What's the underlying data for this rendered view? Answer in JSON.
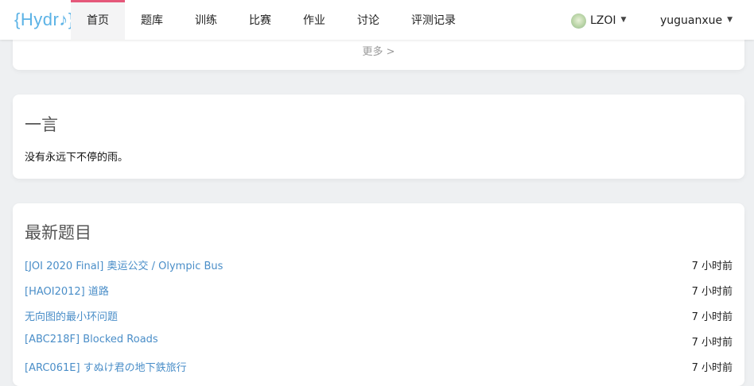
{
  "brand": {
    "logo_text": "{Hydr♪}",
    "accent": "#e5587a",
    "link_color": "#4a8ec8"
  },
  "nav": {
    "items": [
      {
        "label": "首页",
        "active": true
      },
      {
        "label": "题库"
      },
      {
        "label": "训练"
      },
      {
        "label": "比赛"
      },
      {
        "label": "作业"
      },
      {
        "label": "讨论"
      },
      {
        "label": "评测记录"
      }
    ],
    "domain": {
      "label": "LZOI",
      "icon": "domain-avatar"
    },
    "user": {
      "label": "yuguanxue"
    }
  },
  "more": {
    "label": "更多 >"
  },
  "hitokoto": {
    "title": "一言",
    "text": "没有永远下不停的雨。"
  },
  "latest": {
    "title": "最新题目",
    "rows": [
      {
        "title": "[JOI 2020 Final] 奥运公交 / Olympic Bus",
        "time": "7 小时前"
      },
      {
        "title": "[HAOI2012] 道路",
        "time": "7 小时前"
      },
      {
        "title": "无向图的最小环问题",
        "time": "7 小时前"
      },
      {
        "title": "[ABC218F] Blocked Roads",
        "time": "7 小时前"
      },
      {
        "title": "[ARC061E] すぬけ君の地下鉄旅行",
        "time": "7 小时前"
      }
    ]
  }
}
